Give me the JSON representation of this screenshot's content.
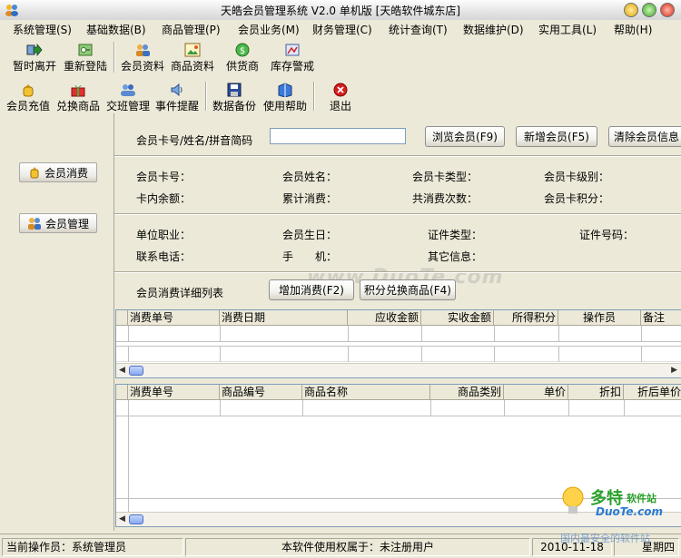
{
  "window": {
    "title": "天皓会员管理系统 V2.0 单机版  [天皓软件城东店]"
  },
  "menu": [
    "系统管理(S)",
    "基础数据(B)",
    "商品管理(P)",
    "会员业务(M)",
    "财务管理(C)",
    "统计查询(T)",
    "数据维护(D)",
    "实用工具(L)",
    "帮助(H)"
  ],
  "toolbar1": [
    "暂时离开",
    "重新登陆",
    "会员资料",
    "商品资料",
    "供货商",
    "库存警戒"
  ],
  "toolbar2": [
    "会员充值",
    "兑换商品",
    "交班管理",
    "事件提醒",
    "数据备份",
    "使用帮助",
    "退出"
  ],
  "sidebar": [
    "会员消费",
    "会员管理"
  ],
  "search": {
    "label": "会员卡号/姓名/拼音简码",
    "value": "",
    "browse": "浏览会员(F9)",
    "add": "新增会员(F5)",
    "clear": "清除会员信息"
  },
  "info1": [
    "会员卡号：",
    "会员姓名：",
    "会员卡类型：",
    "会员卡级别：",
    "卡内余额：",
    "累计消费：",
    "共消费次数：",
    "会员卡积分："
  ],
  "info2": [
    "单位职业：",
    "会员生日：",
    "证件类型：",
    "证件号码：",
    "联系电话：",
    "手　　机：",
    "其它信息："
  ],
  "detail": {
    "label": "会员消费详细列表",
    "add": "增加消费(F2)",
    "exchange": "积分兑换商品(F4)"
  },
  "grid1": {
    "columns": [
      "消费单号",
      "消费日期",
      "应收金额",
      "实收金额",
      "所得积分",
      "操作员",
      "备注"
    ]
  },
  "grid2": {
    "columns": [
      "消费单号",
      "商品编号",
      "商品名称",
      "商品类别",
      "单价",
      "折扣",
      "折后单价"
    ]
  },
  "watermark": "www.DuoTe.com",
  "status": {
    "operator": "当前操作员：系统管理员",
    "license": "本软件使用权属于：未注册用户",
    "date": "2010-11-18",
    "weekday": "星期四"
  },
  "corner_logo": {
    "brand": "多特",
    "brand_suffix": "软件站",
    "site": "DuoTe.com",
    "slogan": "国内最安全的软件站"
  }
}
